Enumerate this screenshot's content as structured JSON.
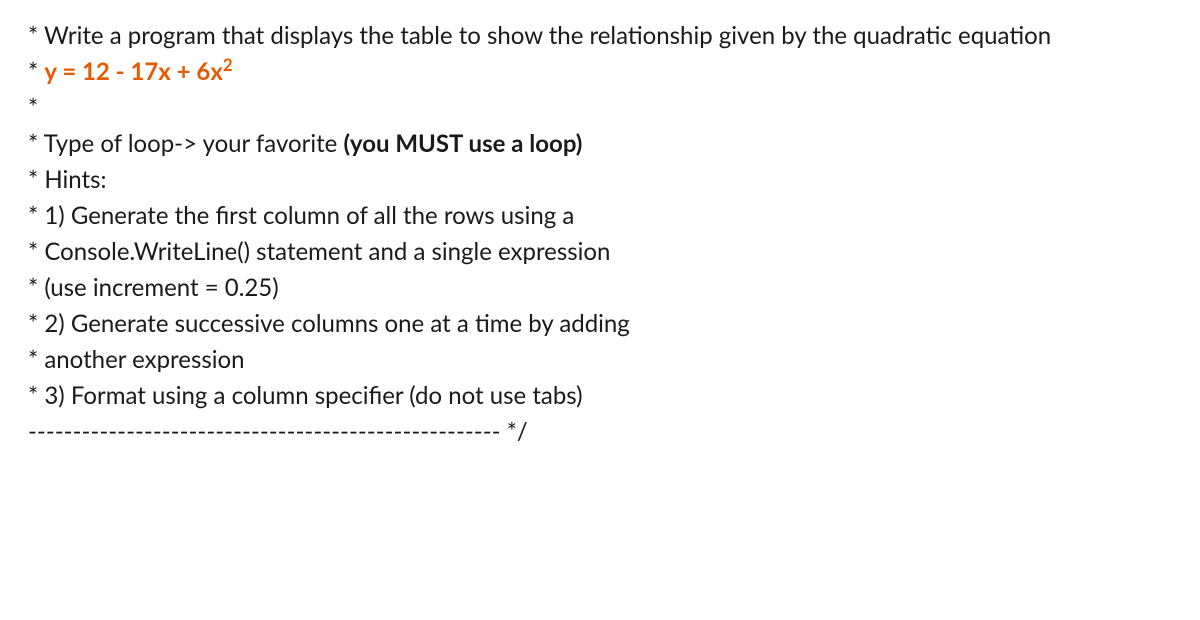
{
  "lines": {
    "l1_prefix": "* ",
    "l1_text": "Write a program that displays the table to show the relationship given by the quadratic equation",
    "l2_prefix": "* ",
    "l2_eq_a": "y = 12 - 17x + 6x",
    "l2_eq_sup": "2",
    "l3": "*",
    "l4_prefix": "* ",
    "l4_text": "Type of loop-> your favorite ",
    "l4_bold": "(you MUST use a loop)",
    "l5_prefix": "* ",
    "l5_text": "Hints:",
    "l6_prefix": "* ",
    "l6_text": "1) Generate the first column of all the rows using a",
    "l7_prefix": "* ",
    "l7_text": "Console.WriteLine() statement and a single expression",
    "l8_prefix": "* ",
    "l8_text": "(use increment = 0.25)",
    "l9_prefix": "* ",
    "l9_text": "2) Generate successive columns one at a time by adding",
    "l10_prefix": "* ",
    "l10_text": "another expression",
    "l11_prefix": "* ",
    "l11_text": "3) Format using a column specifier (do not use tabs)",
    "l12_dashes": "----------------------------------------------------- ",
    "l12_end": "*/"
  }
}
